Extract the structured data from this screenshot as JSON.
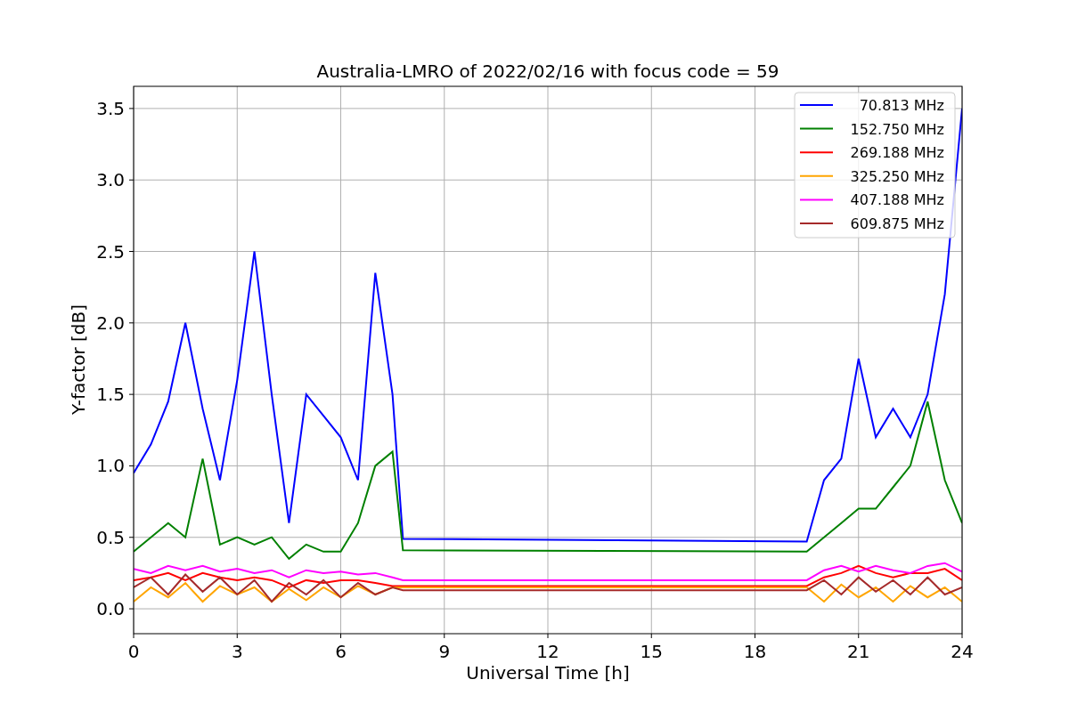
{
  "figure": {
    "chart_data": {
      "type": "line",
      "title": "Australia-LMRO of 2022/02/16 with focus code = 59",
      "xlabel": "Universal Time [h]",
      "ylabel": "Y-factor [dB]",
      "x": [
        0,
        0.5,
        1,
        1.5,
        2,
        2.5,
        3,
        3.5,
        4,
        4.5,
        5,
        5.5,
        6,
        6.5,
        7,
        7.5,
        7.8,
        19.5,
        20,
        20.5,
        21,
        21.5,
        22,
        22.5,
        23,
        23.5,
        24
      ],
      "series": [
        {
          "name": "70.813 MHz",
          "color": "#0000ff",
          "values": [
            0.95,
            1.15,
            1.45,
            2.0,
            1.4,
            0.9,
            1.6,
            2.5,
            1.5,
            0.6,
            1.5,
            1.35,
            1.2,
            0.9,
            2.35,
            1.5,
            0.49,
            0.47,
            0.9,
            1.05,
            1.75,
            1.2,
            1.4,
            1.2,
            1.5,
            2.2,
            3.5
          ]
        },
        {
          "name": "152.750 MHz",
          "color": "#008000",
          "values": [
            0.4,
            0.5,
            0.6,
            0.5,
            1.05,
            0.45,
            0.5,
            0.45,
            0.5,
            0.35,
            0.45,
            0.4,
            0.4,
            0.6,
            1.0,
            1.1,
            0.41,
            0.4,
            0.5,
            0.6,
            0.7,
            0.7,
            0.85,
            1.0,
            1.45,
            0.9,
            0.6
          ]
        },
        {
          "name": "269.188 MHz",
          "color": "#ff0000",
          "values": [
            0.2,
            0.22,
            0.25,
            0.2,
            0.25,
            0.22,
            0.2,
            0.22,
            0.2,
            0.15,
            0.2,
            0.18,
            0.2,
            0.2,
            0.18,
            0.16,
            0.16,
            0.16,
            0.22,
            0.25,
            0.3,
            0.25,
            0.22,
            0.25,
            0.25,
            0.28,
            0.2
          ]
        },
        {
          "name": "325.250 MHz",
          "color": "#ffa500",
          "values": [
            0.05,
            0.15,
            0.08,
            0.18,
            0.05,
            0.16,
            0.1,
            0.15,
            0.05,
            0.14,
            0.06,
            0.15,
            0.08,
            0.16,
            0.1,
            0.15,
            0.15,
            0.15,
            0.05,
            0.17,
            0.08,
            0.15,
            0.05,
            0.16,
            0.08,
            0.15,
            0.05
          ]
        },
        {
          "name": "407.188 MHz",
          "color": "#ff00ff",
          "values": [
            0.28,
            0.25,
            0.3,
            0.27,
            0.3,
            0.26,
            0.28,
            0.25,
            0.27,
            0.22,
            0.27,
            0.25,
            0.26,
            0.24,
            0.25,
            0.22,
            0.2,
            0.2,
            0.27,
            0.3,
            0.26,
            0.3,
            0.27,
            0.25,
            0.3,
            0.32,
            0.26
          ]
        },
        {
          "name": "609.875 MHz",
          "color": "#a52a2a",
          "values": [
            0.15,
            0.22,
            0.1,
            0.24,
            0.12,
            0.22,
            0.1,
            0.2,
            0.05,
            0.18,
            0.1,
            0.2,
            0.08,
            0.18,
            0.1,
            0.15,
            0.13,
            0.13,
            0.2,
            0.1,
            0.22,
            0.12,
            0.2,
            0.1,
            0.22,
            0.1,
            0.15
          ]
        }
      ],
      "grid": true,
      "legend": "upper right",
      "xlim": [
        0,
        24
      ],
      "ylim": [
        -0.174,
        3.655
      ],
      "xticks": [
        0,
        3,
        6,
        9,
        12,
        15,
        18,
        21,
        24
      ],
      "yticks": [
        {
          "value": 0,
          "label": "0.0"
        },
        {
          "value": 0.5,
          "label": "0.5"
        },
        {
          "value": 1,
          "label": "1.0"
        },
        {
          "value": 1.5,
          "label": "1.5"
        },
        {
          "value": 2,
          "label": "2.0"
        },
        {
          "value": 2.5,
          "label": "2.5"
        },
        {
          "value": 3,
          "label": "3.0"
        },
        {
          "value": 3.5,
          "label": "3.5"
        }
      ]
    }
  }
}
